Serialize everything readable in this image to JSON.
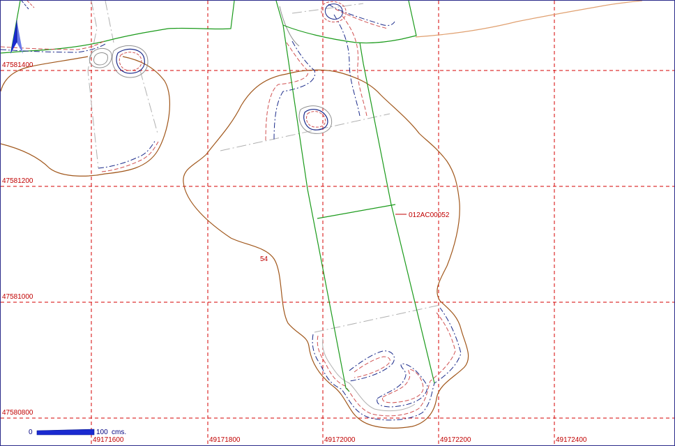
{
  "grid": {
    "x_labels": [
      "49171600",
      "49171800",
      "49172000",
      "49172200",
      "49172400"
    ],
    "y_labels": [
      "47581400",
      "47581200",
      "47581000",
      "47580800"
    ]
  },
  "parcel": {
    "id_label": "012AC00052",
    "number_label": "54"
  },
  "scale": {
    "start_label": "0",
    "end_label": "100",
    "unit_label": "cms."
  },
  "colors": {
    "grid": "#d40000",
    "parcel_line": "#1a9a1a",
    "contour": "#a0561a",
    "north_arrow": "#1a2ad0"
  },
  "icons": {
    "north_arrow": "north-arrow-icon"
  }
}
